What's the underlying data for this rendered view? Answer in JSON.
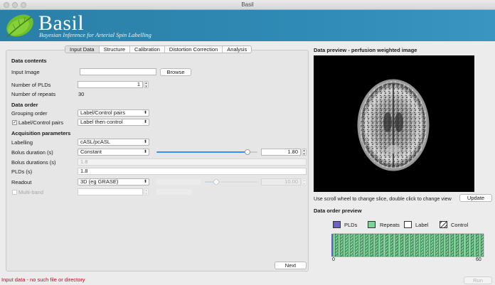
{
  "window": {
    "title": "Basil"
  },
  "banner": {
    "title": "Basil",
    "subtitle": "Bayesian Inference for Arterial Spin Labelling",
    "color": "#2f8ab5"
  },
  "tabs": [
    {
      "label": "Input Data",
      "active": true
    },
    {
      "label": "Structure",
      "active": false
    },
    {
      "label": "Calibration",
      "active": false
    },
    {
      "label": "Distortion Correction",
      "active": false
    },
    {
      "label": "Analysis",
      "active": false
    }
  ],
  "data_contents": {
    "heading": "Data contents",
    "input_image_label": "Input Image",
    "input_image_value": "",
    "browse_label": "Browse",
    "num_plds_label": "Number of PLDs",
    "num_plds_value": "1",
    "num_repeats_label": "Number of repeats",
    "num_repeats_value": "30"
  },
  "data_order": {
    "heading": "Data order",
    "grouping_label": "Grouping order",
    "grouping_value": "Label/Control pairs",
    "pairs_label": "Label/Control pairs",
    "pairs_checked": true,
    "pairs_value": "Label then control"
  },
  "acquisition": {
    "heading": "Acquisition parameters",
    "labelling_label": "Labelling",
    "labelling_value": "cASL/pcASL",
    "bolus_duration_label": "Bolus duration (s)",
    "bolus_duration_mode": "Constant",
    "bolus_duration_value": "1.80",
    "bolus_duration_slider": 0.9,
    "bolus_durations_label": "Bolus durations (s)",
    "bolus_durations_value": "1.8",
    "plds_label": "PLDs (s)",
    "plds_value": "1.8",
    "readout_label": "Readout",
    "readout_value": "3D (eg GRASE)",
    "readout_param_value": "10.00",
    "readout_slider": 0.3,
    "multiband_label": "Multi-band",
    "multiband_checked": false
  },
  "nav": {
    "next_label": "Next"
  },
  "preview": {
    "title": "Data preview - perfusion weighted image",
    "hint": "Use scroll wheel to change slice, double click to change view",
    "update_label": "Update"
  },
  "data_order_preview": {
    "title": "Data order preview",
    "legend": [
      {
        "label": "PLDs",
        "color": "#6a62c8"
      },
      {
        "label": "Repeats",
        "color": "#7ed39a"
      },
      {
        "label": "Label",
        "color": "#ffffff"
      },
      {
        "label": "Control",
        "color": "hatched"
      }
    ],
    "axis_min": "0",
    "axis_max": "60",
    "volumes": 60
  },
  "status": {
    "error_text": "Input data - no such file or directory",
    "run_label": "Run"
  }
}
